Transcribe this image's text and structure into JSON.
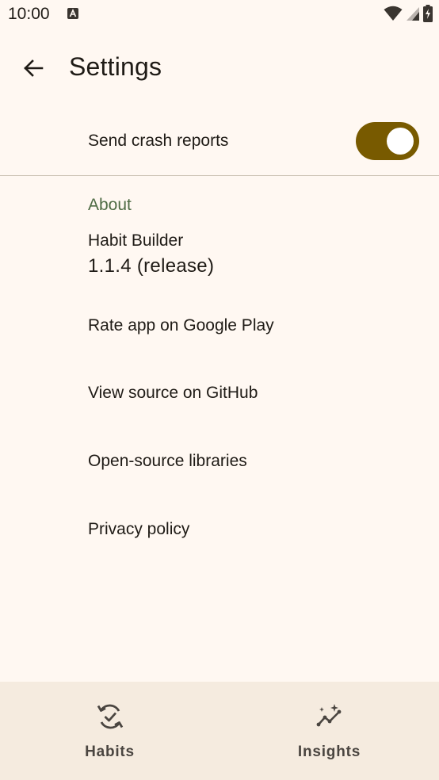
{
  "status_bar": {
    "time": "10:00"
  },
  "app_bar": {
    "title": "Settings"
  },
  "settings": {
    "crash_reports_label": "Send crash reports",
    "crash_reports_enabled": true
  },
  "about": {
    "header": "About",
    "app_name": "Habit Builder",
    "version": "1.1.4 (release)",
    "links": [
      {
        "label": "Rate app on Google Play"
      },
      {
        "label": "View source on GitHub"
      },
      {
        "label": "Open-source libraries"
      },
      {
        "label": "Privacy policy"
      }
    ]
  },
  "bottom_nav": {
    "items": [
      {
        "label": "Habits",
        "icon": "habits-check-cycle-icon"
      },
      {
        "label": "Insights",
        "icon": "insights-sparkle-chart-icon"
      }
    ]
  },
  "colors": {
    "background": "#fff8f2",
    "toggle_on": "#785a00",
    "section_header": "#4f6c45",
    "bottom_nav_bg": "#f5ebdf"
  }
}
